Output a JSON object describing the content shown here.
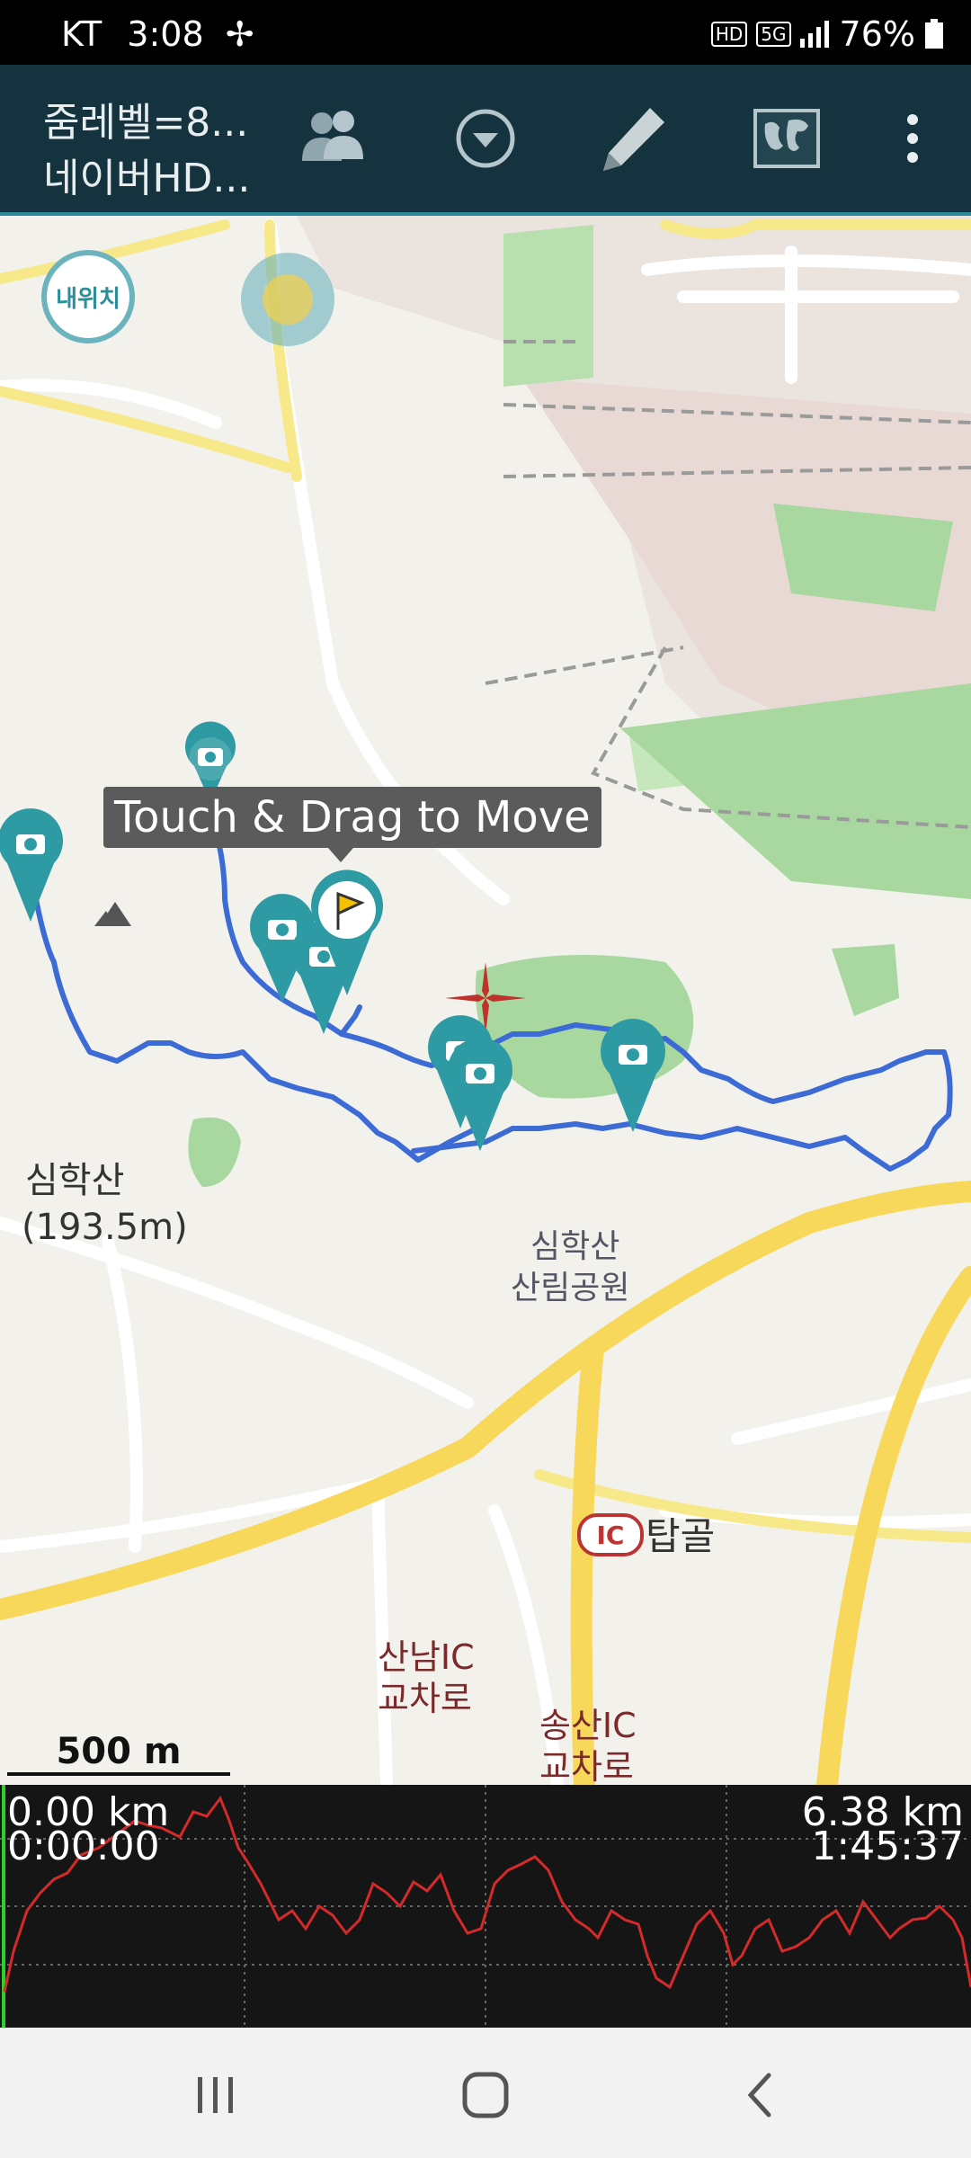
{
  "status_bar": {
    "carrier": "KT",
    "time": "3:08",
    "hd_badge": "HD",
    "network": "5G",
    "battery": "76%"
  },
  "toolbar": {
    "title_line1": "줌레벨=8...",
    "title_line2": "네이버HD...",
    "icons": [
      "people-icon",
      "dropdown-circle-icon",
      "pencil-icon",
      "map-icon",
      "more-vert-icon"
    ]
  },
  "map": {
    "my_location_label": "내위치",
    "tooltip": "Touch & Drag to Move",
    "labels": {
      "mountain_name": "심학산",
      "mountain_elev": "(193.5m)",
      "park_line1": "심학산",
      "park_line2": "산림공원",
      "ic_badge": "IC",
      "tapgol": "탑골",
      "sannam_line1": "산남IC",
      "sannam_line2": "교차로",
      "songsan_line1": "송산IC",
      "songsan_line2": "교차로"
    },
    "colors": {
      "track": "#3d6bd6",
      "pin": "#2e9aa3",
      "cursor": "#c0312b",
      "park": "#a8d8a0",
      "road_major": "#f8d85a"
    }
  },
  "scale": {
    "label": "500 m"
  },
  "elevation": {
    "start_distance": "0.00 km",
    "start_time": "0:00:00",
    "end_distance": "6.38 km",
    "end_time": "1:45:37",
    "line_color": "#d52a2a"
  },
  "nav_bar": {
    "icons": [
      "recents-icon",
      "home-icon",
      "back-icon"
    ]
  }
}
